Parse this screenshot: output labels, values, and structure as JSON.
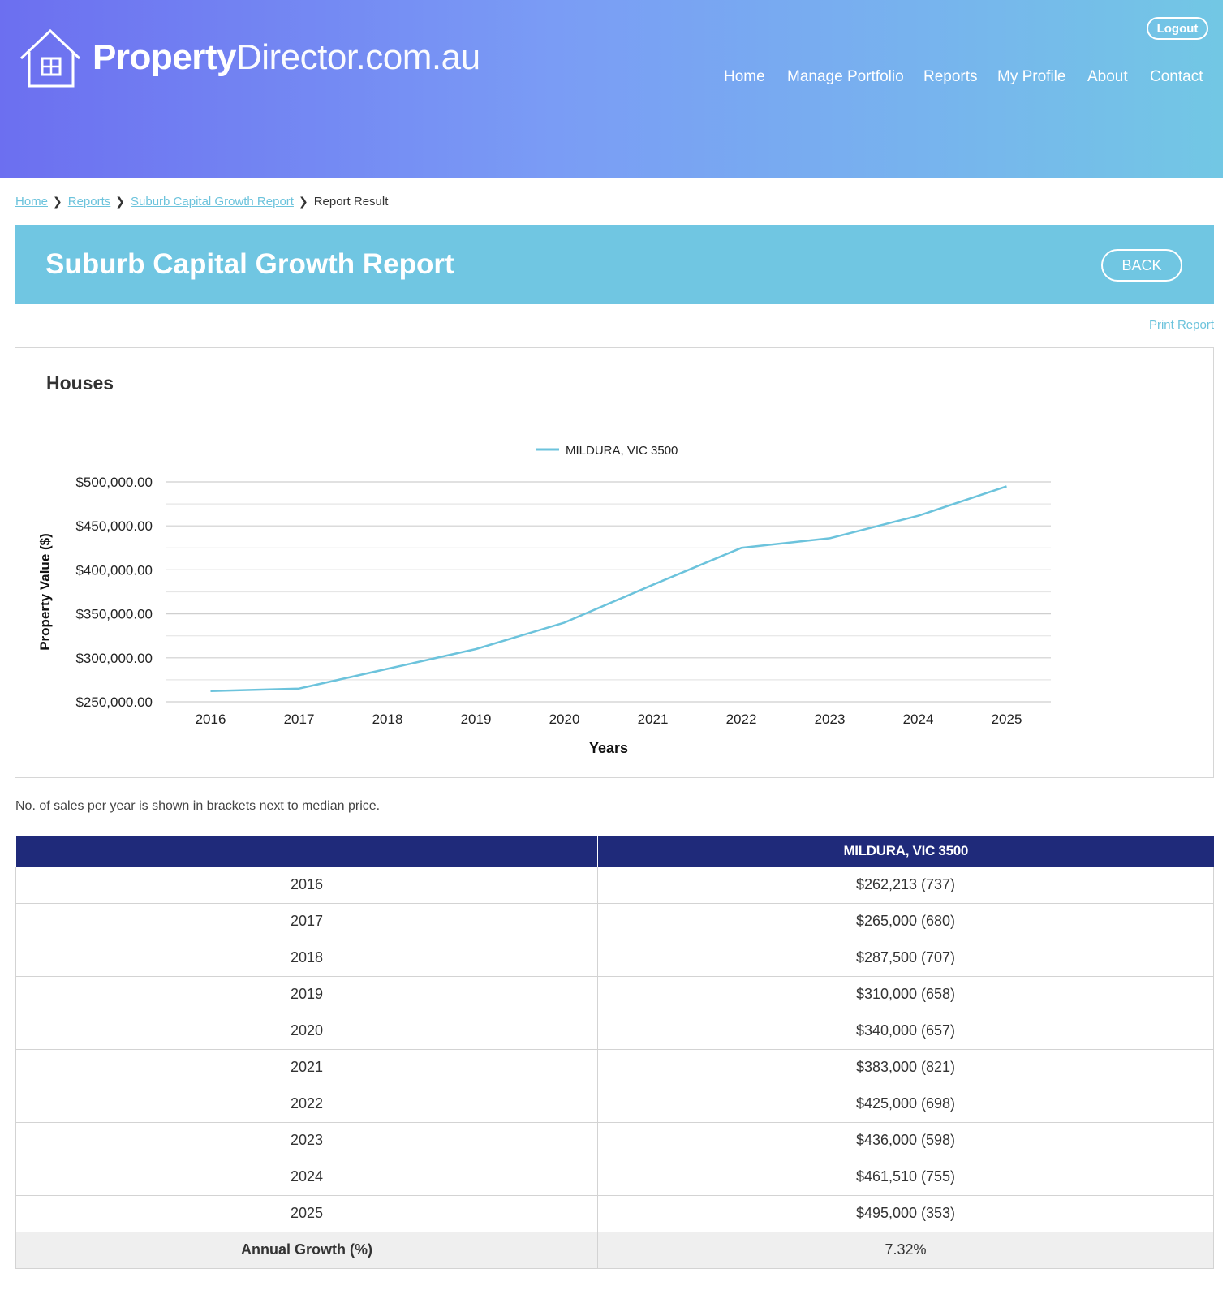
{
  "brand": {
    "name_bold": "Property",
    "name_light": "Director.com.au"
  },
  "header": {
    "logout_label": "Logout",
    "nav": [
      "Home",
      "Manage Portfolio",
      "Reports",
      "My Profile",
      "About",
      "Contact"
    ]
  },
  "breadcrumb": [
    "Home",
    "Reports",
    "Suburb Capital Growth Report",
    "Report Result"
  ],
  "page": {
    "title": "Suburb Capital Growth Report",
    "back_label": "BACK",
    "print_label": "Print Report",
    "section_title": "Houses",
    "note": "No. of sales per year is shown in brackets next to median price."
  },
  "colors": {
    "accent": "#70c6e2",
    "table_header": "#1f2a7a",
    "line": "#6cc3dc"
  },
  "chart_data": {
    "type": "line",
    "xlabel": "Years",
    "ylabel": "Property Value ($)",
    "x": [
      2016,
      2017,
      2018,
      2019,
      2020,
      2021,
      2022,
      2023,
      2024,
      2025
    ],
    "series": [
      {
        "name": "MILDURA, VIC 3500",
        "values": [
          262213,
          265000,
          287500,
          310000,
          340000,
          383000,
          425000,
          436000,
          461510,
          495000
        ]
      }
    ],
    "ylim": [
      250000,
      500000
    ],
    "yticks": [
      "$250,000.00",
      "$300,000.00",
      "$350,000.00",
      "$400,000.00",
      "$450,000.00",
      "$500,000.00"
    ],
    "grid": true,
    "legend": "top-center"
  },
  "table": {
    "column_header": "MILDURA, VIC 3500",
    "rows": [
      {
        "year": "2016",
        "value": "$262,213 (737)"
      },
      {
        "year": "2017",
        "value": "$265,000 (680)"
      },
      {
        "year": "2018",
        "value": "$287,500 (707)"
      },
      {
        "year": "2019",
        "value": "$310,000 (658)"
      },
      {
        "year": "2020",
        "value": "$340,000 (657)"
      },
      {
        "year": "2021",
        "value": "$383,000 (821)"
      },
      {
        "year": "2022",
        "value": "$425,000 (698)"
      },
      {
        "year": "2023",
        "value": "$436,000 (598)"
      },
      {
        "year": "2024",
        "value": "$461,510 (755)"
      },
      {
        "year": "2025",
        "value": "$495,000 (353)"
      }
    ],
    "growth_label": "Annual Growth (%)",
    "growth_value": "7.32%"
  }
}
